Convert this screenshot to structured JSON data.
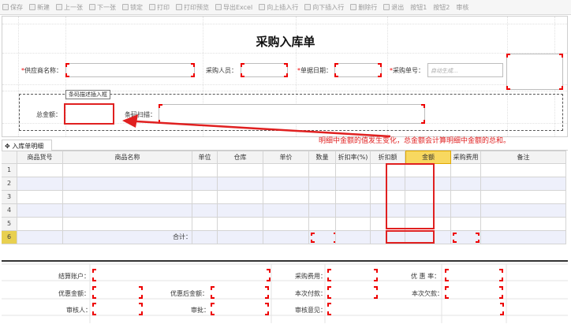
{
  "toolbar": {
    "items": [
      {
        "label": "保存",
        "icon": "save-icon"
      },
      {
        "label": "新建",
        "icon": "new-icon"
      },
      {
        "label": "上一张",
        "icon": "prev-icon"
      },
      {
        "label": "下一张",
        "icon": "next-icon"
      },
      {
        "label": "锁定",
        "icon": "lock-icon"
      },
      {
        "label": "打印",
        "icon": "print-icon"
      },
      {
        "label": "打印预览",
        "icon": "print-preview-icon"
      },
      {
        "label": "导出Excel",
        "icon": "excel-icon"
      },
      {
        "label": "向上插入行",
        "icon": "insert-above-icon"
      },
      {
        "label": "向下插入行",
        "icon": "insert-below-icon"
      },
      {
        "label": "删除行",
        "icon": "delete-row-icon"
      },
      {
        "label": "退出",
        "icon": "exit-icon"
      },
      {
        "label": "按钮1",
        "icon": ""
      },
      {
        "label": "按钮2",
        "icon": ""
      },
      {
        "label": "审核",
        "icon": ""
      }
    ]
  },
  "form": {
    "title": "采购入库单",
    "required_mark": "*",
    "supplier_label": "供应商名称：",
    "buyer_label": "采购人员：",
    "date_label": "单据日期：",
    "order_no_label": "采购单号：",
    "order_no_placeholder": "自动生成...",
    "barcode_group_title": "条码描述插入框",
    "total_label": "总金额：",
    "barcode_label": "条码扫描："
  },
  "annotation": "明细中金额的值发生变化，总金额会计算明细中金额的总和。",
  "tab": {
    "label": "入库单明细"
  },
  "grid": {
    "columns": [
      "",
      "商品货号",
      "商品名称",
      "单位",
      "仓库",
      "单价",
      "数量",
      "折扣率(%)",
      "折扣额",
      "金额",
      "采购费用",
      "备注"
    ],
    "row_numbers": [
      "1",
      "2",
      "3",
      "4",
      "5",
      "6"
    ],
    "total_label": "合计："
  },
  "footer": {
    "settle_account": "结算账户：",
    "purchase_fee": "采购费用：",
    "discount_rate": "优 惠 率：",
    "discount_amount": "优惠金额：",
    "after_discount": "优惠后金额：",
    "paid_now": "本次付款：",
    "owed_now": "本次欠款：",
    "auditor": "审核人：",
    "approve": "审批：",
    "review_opinion": "审核意见："
  },
  "colors": {
    "accent_red": "#e02020",
    "header_amount": "#f8d860",
    "zebra": "#eef0fb"
  }
}
